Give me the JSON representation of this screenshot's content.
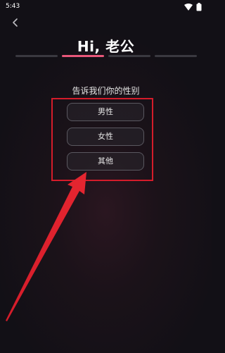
{
  "status_bar": {
    "time": "5:43",
    "icons": [
      "wifi-icon",
      "battery-icon"
    ]
  },
  "header": {
    "back_icon": "chevron-left-icon",
    "title": "Hi, 老公"
  },
  "progress": {
    "total_steps": 4,
    "current_step": 2,
    "active_color": "#e8577a",
    "inactive_color": "#3a3940"
  },
  "question": {
    "text": "告诉我们你的性别"
  },
  "options": [
    {
      "label": "男性"
    },
    {
      "label": "女性"
    },
    {
      "label": "其他"
    }
  ],
  "annotation": {
    "highlight_color": "#d41c2a"
  }
}
